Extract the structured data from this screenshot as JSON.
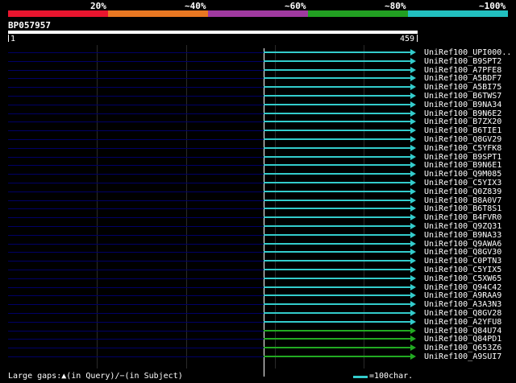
{
  "identity_scale": {
    "labels": [
      "20%",
      "~40%",
      "~60%",
      "~80%",
      "~100%"
    ],
    "colors": [
      "#e8152e",
      "#e87722",
      "#a03aa0",
      "#22a022",
      "#22c0c0"
    ]
  },
  "query": {
    "id": "BP057957",
    "start": "1",
    "end": "459"
  },
  "hits": [
    {
      "label": "UniRef100_UPI000..",
      "color": "#3cc"
    },
    {
      "label": "UniRef100_B9SPT2",
      "color": "#3cc"
    },
    {
      "label": "UniRef100_A7PFE8",
      "color": "#3cc"
    },
    {
      "label": "UniRef100_A5BDF7",
      "color": "#3cc"
    },
    {
      "label": "UniRef100_A5BI75",
      "color": "#3cc"
    },
    {
      "label": "UniRef100_B6TWS7",
      "color": "#3cc"
    },
    {
      "label": "UniRef100_B9NA34",
      "color": "#3cc"
    },
    {
      "label": "UniRef100_B9N6E2",
      "color": "#3cc"
    },
    {
      "label": "UniRef100_B7ZX20",
      "color": "#3cc"
    },
    {
      "label": "UniRef100_B6TIE1",
      "color": "#3cc"
    },
    {
      "label": "UniRef100_Q8GV29",
      "color": "#3cc"
    },
    {
      "label": "UniRef100_C5YFK8",
      "color": "#3cc"
    },
    {
      "label": "UniRef100_B9SPT1",
      "color": "#3cc"
    },
    {
      "label": "UniRef100_B9N6E1",
      "color": "#3cc"
    },
    {
      "label": "UniRef100_Q9M085",
      "color": "#3cc"
    },
    {
      "label": "UniRef100_C5YIX3",
      "color": "#3cc"
    },
    {
      "label": "UniRef100_Q0Z839",
      "color": "#3cc"
    },
    {
      "label": "UniRef100_B8A0V7",
      "color": "#3cc"
    },
    {
      "label": "UniRef100_B6T8S1",
      "color": "#3cc"
    },
    {
      "label": "UniRef100_B4FVR0",
      "color": "#3cc"
    },
    {
      "label": "UniRef100_Q9ZQ31",
      "color": "#3cc"
    },
    {
      "label": "UniRef100_B9NA33",
      "color": "#3cc"
    },
    {
      "label": "UniRef100_Q9AWA6",
      "color": "#3cc"
    },
    {
      "label": "UniRef100_Q8GV30",
      "color": "#3cc"
    },
    {
      "label": "UniRef100_C0PTN3",
      "color": "#3cc"
    },
    {
      "label": "UniRef100_C5YIX5",
      "color": "#3cc"
    },
    {
      "label": "UniRef100_C5XW65",
      "color": "#3cc"
    },
    {
      "label": "UniRef100_Q94C42",
      "color": "#3cc"
    },
    {
      "label": "UniRef100_A9RAA9",
      "color": "#3cc"
    },
    {
      "label": "UniRef100_A3A3N3",
      "color": "#3cc"
    },
    {
      "label": "UniRef100_Q8GV28",
      "color": "#3cc"
    },
    {
      "label": "UniRef100_A2YFU8",
      "color": "#3cc"
    },
    {
      "label": "UniRef100_Q84U74",
      "color": "#2a2"
    },
    {
      "label": "UniRef100_Q84PD1",
      "color": "#2a2"
    },
    {
      "label": "UniRef100_Q653Z6",
      "color": "#2a2"
    },
    {
      "label": "UniRef100_A9SUI7",
      "color": "#2a2"
    }
  ],
  "footer": {
    "gaps_text": "Large gaps:▲(in Query)/−(in Subject)",
    "legend_text": "=100char."
  }
}
